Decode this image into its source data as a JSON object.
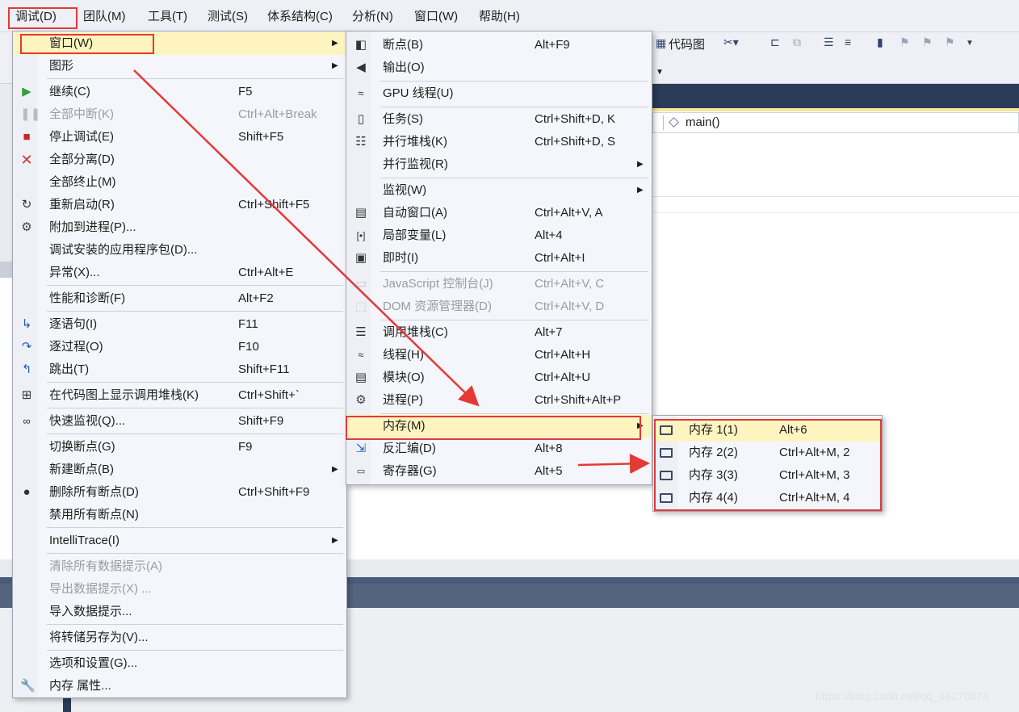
{
  "menubar": {
    "items": [
      "调试(D)",
      "团队(M)",
      "工具(T)",
      "测试(S)",
      "体系结构(C)",
      "分析(N)",
      "窗口(W)",
      "帮助(H)"
    ]
  },
  "toolbar": {
    "code_map_label": "代码图"
  },
  "editor": {
    "function_label": "main()"
  },
  "debug_menu": {
    "items": [
      {
        "label": "窗口(W)",
        "shortcut": "",
        "submenu": true,
        "highlighted": true
      },
      {
        "label": "图形",
        "shortcut": "",
        "submenu": true
      },
      {
        "label": "继续(C)",
        "shortcut": "F5",
        "icon": "continue-icon"
      },
      {
        "label": "全部中断(K)",
        "shortcut": "Ctrl+Alt+Break",
        "disabled": true,
        "icon": "pause-icon"
      },
      {
        "label": "停止调试(E)",
        "shortcut": "Shift+F5",
        "icon": "stop-icon"
      },
      {
        "label": "全部分离(D)",
        "shortcut": "",
        "icon": "detach-icon"
      },
      {
        "label": "全部终止(M)",
        "shortcut": ""
      },
      {
        "label": "重新启动(R)",
        "shortcut": "Ctrl+Shift+F5",
        "icon": "restart-icon"
      },
      {
        "label": "附加到进程(P)...",
        "shortcut": "",
        "icon": "attach-icon"
      },
      {
        "label": "调试安装的应用程序包(D)...",
        "shortcut": ""
      },
      {
        "label": "异常(X)...",
        "shortcut": "Ctrl+Alt+E"
      },
      {
        "label": "性能和诊断(F)",
        "shortcut": "Alt+F2"
      },
      {
        "label": "逐语句(I)",
        "shortcut": "F11",
        "icon": "step-into-icon"
      },
      {
        "label": "逐过程(O)",
        "shortcut": "F10",
        "icon": "step-over-icon"
      },
      {
        "label": "跳出(T)",
        "shortcut": "Shift+F11",
        "icon": "step-out-icon"
      },
      {
        "label": "在代码图上显示调用堆栈(K)",
        "shortcut": "Ctrl+Shift+`",
        "icon": "code-map-icon"
      },
      {
        "label": "快速监视(Q)...",
        "shortcut": "Shift+F9",
        "icon": "glasses-icon"
      },
      {
        "label": "切换断点(G)",
        "shortcut": "F9"
      },
      {
        "label": "新建断点(B)",
        "shortcut": "",
        "submenu": true
      },
      {
        "label": "删除所有断点(D)",
        "shortcut": "Ctrl+Shift+F9",
        "icon": "delete-breakpoints-icon"
      },
      {
        "label": "禁用所有断点(N)",
        "shortcut": ""
      },
      {
        "label": "IntelliTrace(I)",
        "shortcut": "",
        "submenu": true
      },
      {
        "label": "清除所有数据提示(A)",
        "shortcut": "",
        "disabled": true
      },
      {
        "label": "导出数据提示(X) ...",
        "shortcut": "",
        "disabled": true
      },
      {
        "label": "导入数据提示...",
        "shortcut": ""
      },
      {
        "label": "将转储另存为(V)...",
        "shortcut": ""
      },
      {
        "label": "选项和设置(G)...",
        "shortcut": ""
      },
      {
        "label": "内存 属性...",
        "shortcut": "",
        "icon": "wrench-icon"
      }
    ]
  },
  "windows_menu": {
    "items": [
      {
        "label": "断点(B)",
        "shortcut": "Alt+F9",
        "icon": "breakpoints-icon"
      },
      {
        "label": "输出(O)",
        "shortcut": "",
        "icon": "output-icon"
      },
      {
        "label": "GPU 线程(U)",
        "shortcut": "",
        "icon": "gpu-threads-icon"
      },
      {
        "label": "任务(S)",
        "shortcut": "Ctrl+Shift+D, K",
        "icon": "tasks-icon"
      },
      {
        "label": "并行堆栈(K)",
        "shortcut": "Ctrl+Shift+D, S",
        "icon": "parallel-stacks-icon"
      },
      {
        "label": "并行监视(R)",
        "shortcut": "",
        "submenu": true
      },
      {
        "label": "监视(W)",
        "shortcut": "",
        "submenu": true
      },
      {
        "label": "自动窗口(A)",
        "shortcut": "Ctrl+Alt+V, A",
        "icon": "autos-icon"
      },
      {
        "label": "局部变量(L)",
        "shortcut": "Alt+4",
        "icon": "locals-icon"
      },
      {
        "label": "即时(I)",
        "shortcut": "Ctrl+Alt+I",
        "icon": "immediate-icon"
      },
      {
        "label": "JavaScript 控制台(J)",
        "shortcut": "Ctrl+Alt+V, C",
        "disabled": true,
        "icon": "js-console-icon"
      },
      {
        "label": "DOM 资源管理器(D)",
        "shortcut": "Ctrl+Alt+V, D",
        "disabled": true,
        "icon": "dom-explorer-icon"
      },
      {
        "label": "调用堆栈(C)",
        "shortcut": "Alt+7",
        "icon": "call-stack-icon"
      },
      {
        "label": "线程(H)",
        "shortcut": "Ctrl+Alt+H",
        "icon": "threads-icon"
      },
      {
        "label": "模块(O)",
        "shortcut": "Ctrl+Alt+U",
        "icon": "modules-icon"
      },
      {
        "label": "进程(P)",
        "shortcut": "Ctrl+Shift+Alt+P",
        "icon": "processes-icon"
      },
      {
        "label": "内存(M)",
        "shortcut": "",
        "submenu": true,
        "highlighted": true
      },
      {
        "label": "反汇编(D)",
        "shortcut": "Alt+8",
        "icon": "disassembly-icon"
      },
      {
        "label": "寄存器(G)",
        "shortcut": "Alt+5",
        "icon": "registers-icon"
      }
    ]
  },
  "memory_menu": {
    "items": [
      {
        "label": "内存 1(1)",
        "shortcut": "Alt+6",
        "highlighted": true
      },
      {
        "label": "内存 2(2)",
        "shortcut": "Ctrl+Alt+M, 2"
      },
      {
        "label": "内存 3(3)",
        "shortcut": "Ctrl+Alt+M, 3"
      },
      {
        "label": "内存 4(4)",
        "shortcut": "Ctrl+Alt+M, 4"
      }
    ]
  },
  "watermark": "https://blog.csdn.net/qq_34270874",
  "colors": {
    "highlight": "#fdf4bf",
    "annotation_red": "#e53935",
    "ide_dark": "#2b3a57"
  }
}
